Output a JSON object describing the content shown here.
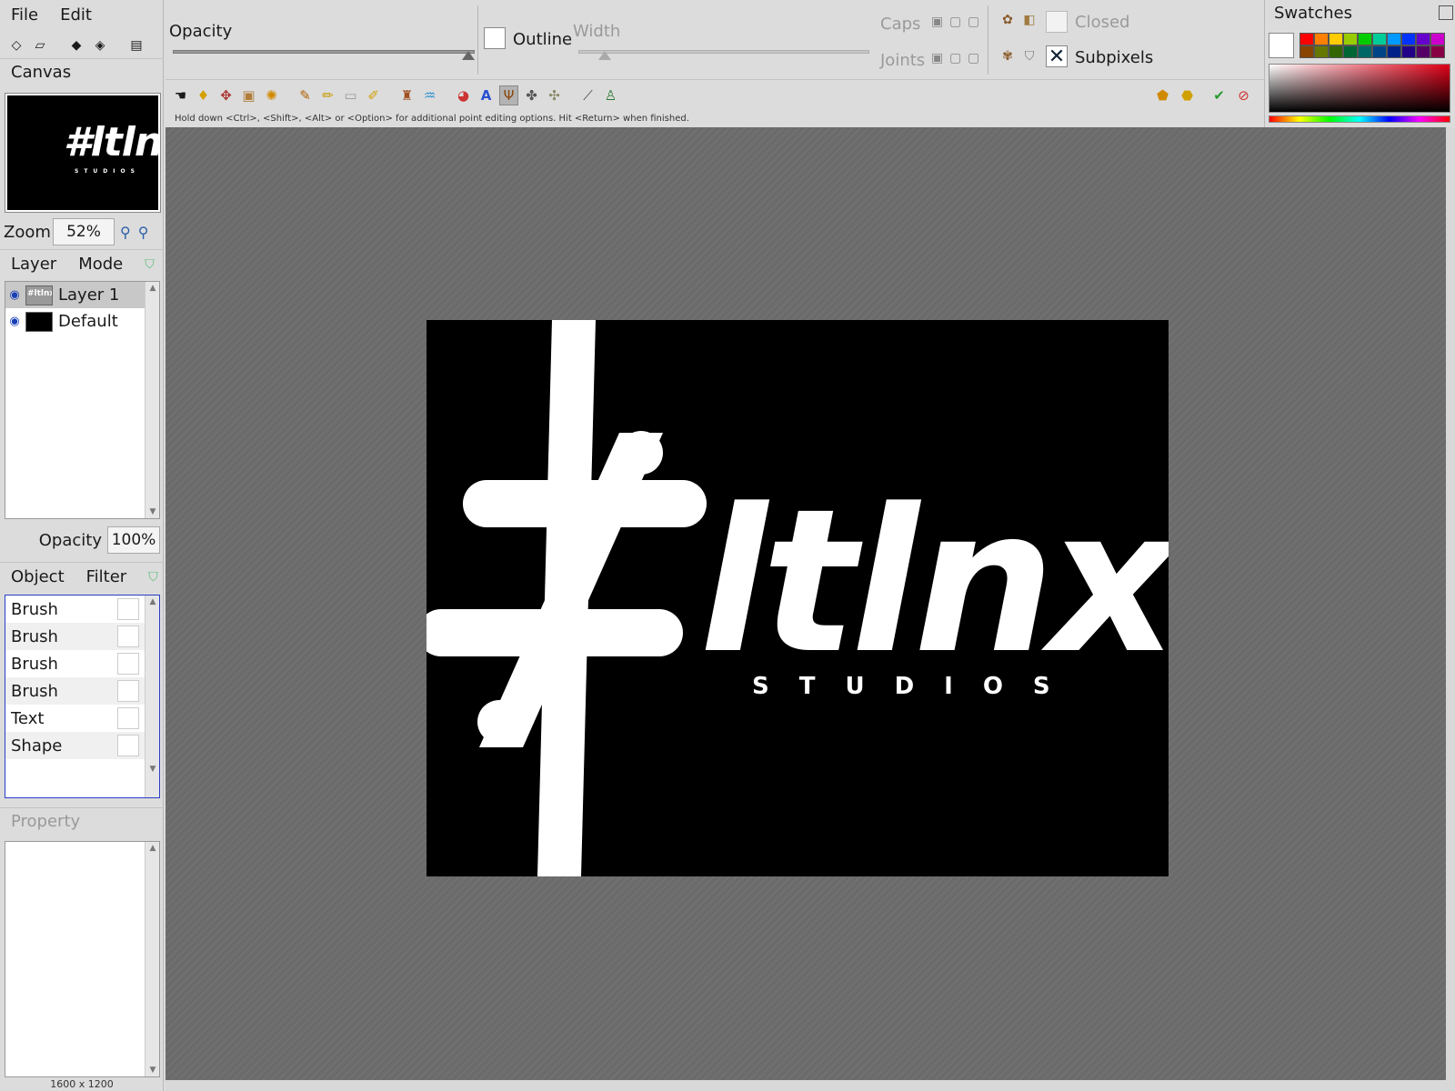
{
  "menu": {
    "file": "File",
    "edit": "Edit"
  },
  "panels": {
    "canvas": "Canvas",
    "zoom_label": "Zoom",
    "zoom_value": "52%",
    "layer_tab": "Layer",
    "mode_tab": "Mode",
    "layers": [
      {
        "name": "Layer 1",
        "selected": true
      },
      {
        "name": "Default",
        "selected": false
      }
    ],
    "opacity_label": "Opacity",
    "opacity_value": "100%",
    "object_tab": "Object",
    "filter_tab": "Filter",
    "objects": [
      "Brush",
      "Brush",
      "Brush",
      "Brush",
      "Text",
      "Shape"
    ],
    "property": "Property",
    "canvas_size": "1600 x 1200"
  },
  "options": {
    "opacity": "Opacity",
    "outline": "Outline",
    "width": "Width",
    "caps": "Caps",
    "joints": "Joints",
    "closed": "Closed",
    "subpixels": "Subpixels",
    "subpixels_checked": "✕"
  },
  "hint": "Hold down <Ctrl>, <Shift>, <Alt> or <Option> for additional point editing options. Hit <Return> when finished.",
  "swatches": {
    "title": "Swatches",
    "current": "#ffffff",
    "palette": [
      "#ff0000",
      "#ff8000",
      "#ffcc00",
      "#99cc00",
      "#00cc00",
      "#00cc99",
      "#0099ff",
      "#0033ff",
      "#6600cc",
      "#cc00cc",
      "#884400",
      "#667700",
      "#336600",
      "#006633",
      "#006666",
      "#004488",
      "#002288",
      "#220088",
      "#550066",
      "#880044"
    ]
  },
  "artwork": {
    "logo_text": "#ltlnx",
    "sub_text": "STUDIOS"
  }
}
